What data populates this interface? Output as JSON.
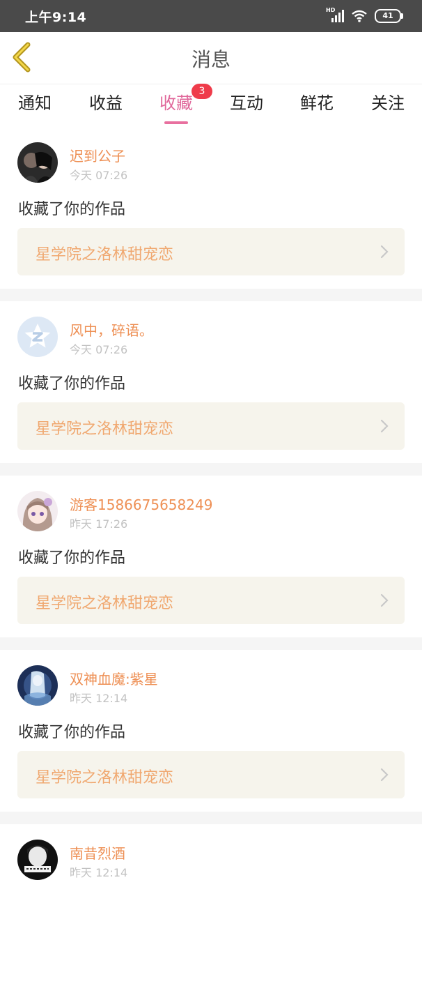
{
  "status_bar": {
    "time": "上午9:14",
    "network": "HD",
    "battery": "41"
  },
  "header": {
    "title": "消息",
    "back_icon": "chevron-left-icon"
  },
  "tabs": [
    {
      "label": "通知"
    },
    {
      "label": "收益"
    },
    {
      "label": "收藏",
      "badge": "3",
      "active": true
    },
    {
      "label": "互动"
    },
    {
      "label": "鲜花"
    },
    {
      "label": "关注"
    }
  ],
  "messages": [
    {
      "username": "迟到公子",
      "time": "今天 07:26",
      "action": "收藏了你的作品",
      "work_title": "星学院之洛林甜宠恋"
    },
    {
      "username": "风中，碎语。",
      "time": "今天 07:26",
      "action": "收藏了你的作品",
      "work_title": "星学院之洛林甜宠恋"
    },
    {
      "username": "游客1586675658249",
      "time": "昨天 17:26",
      "action": "收藏了你的作品",
      "work_title": "星学院之洛林甜宠恋"
    },
    {
      "username": "双神血魔:紫星",
      "time": "昨天 12:14",
      "action": "收藏了你的作品",
      "work_title": "星学院之洛林甜宠恋"
    },
    {
      "username": "南昔烈酒",
      "time": "昨天 12:14"
    }
  ],
  "colors": {
    "accent": "#e0679a",
    "badge": "#ef3b4a",
    "username": "#ee9055",
    "work_title": "#f0a870",
    "card_bg": "#f6f4ec"
  }
}
